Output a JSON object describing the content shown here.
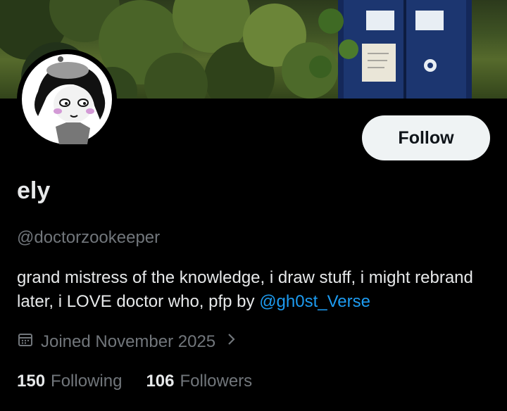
{
  "profile": {
    "display_name": "ely",
    "handle": "@doctorzookeeper",
    "bio_text": "grand mistress of the knowledge, i draw stuff, i might rebrand later, i LOVE doctor who, pfp by ",
    "bio_mention": "@gh0st_Verse",
    "joined": "Joined November 2025",
    "follow_label": "Follow"
  },
  "stats": {
    "following_count": "150",
    "following_label": "Following",
    "followers_count": "106",
    "followers_label": "Followers"
  },
  "icons": {
    "calendar": "calendar-icon",
    "chevron": "chevron-right-icon"
  },
  "colors": {
    "background": "#000000",
    "text": "#e7e9ea",
    "muted": "#71767b",
    "link": "#1d9bf0",
    "button_bg": "#eff3f4",
    "button_text": "#0f1419"
  }
}
